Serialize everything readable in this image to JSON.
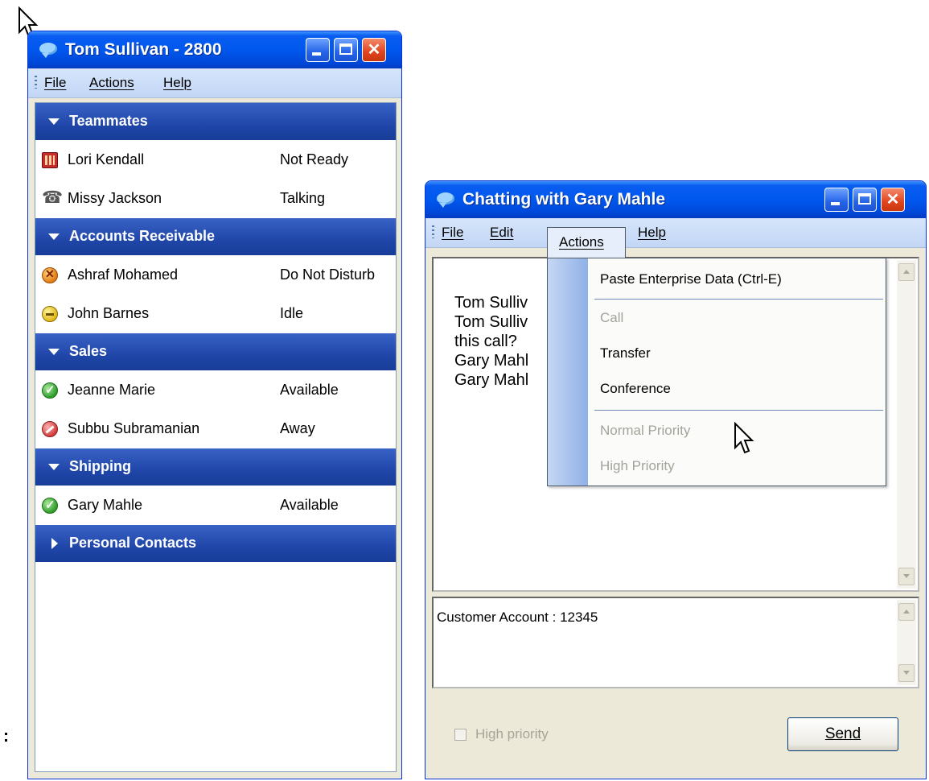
{
  "contacts_window": {
    "title": "Tom Sullivan - 2800",
    "menu": [
      "File",
      "Actions",
      "Help"
    ],
    "groups": [
      {
        "name": "Teammates",
        "expanded": true,
        "contacts": [
          {
            "name": "Lori Kendall",
            "status": "Not Ready",
            "icon": "not-ready-icon"
          },
          {
            "name": "Missy Jackson",
            "status": "Talking",
            "icon": "phone-handset-icon"
          }
        ]
      },
      {
        "name": "Accounts Receivable",
        "expanded": true,
        "contacts": [
          {
            "name": "Ashraf Mohamed",
            "status": "Do Not Disturb",
            "icon": "do-not-disturb-icon"
          },
          {
            "name": "John Barnes",
            "status": "Idle",
            "icon": "idle-icon"
          }
        ]
      },
      {
        "name": "Sales",
        "expanded": true,
        "contacts": [
          {
            "name": "Jeanne Marie",
            "status": "Available",
            "icon": "available-check-icon"
          },
          {
            "name": "Subbu Subramanian",
            "status": "Away",
            "icon": "away-icon"
          }
        ]
      },
      {
        "name": "Shipping",
        "expanded": true,
        "contacts": [
          {
            "name": "Gary Mahle",
            "status": "Available",
            "icon": "available-check-icon"
          }
        ]
      },
      {
        "name": "Personal Contacts",
        "expanded": false,
        "contacts": []
      }
    ]
  },
  "chat_window": {
    "title": "Chatting with Gary Mahle",
    "menu": [
      "File",
      "Edit",
      "Actions",
      "Help"
    ],
    "transcript": [
      "Tom Sulliv",
      "Tom Sulliv",
      "this call?",
      "Gary Mahl",
      "Gary Mahl"
    ],
    "compose_text": "Customer Account : 12345",
    "high_priority_label": "High priority",
    "high_priority_checked": false,
    "send_label": "Send",
    "actions_menu": [
      {
        "label": "Paste Enterprise Data (Ctrl-E)",
        "enabled": true
      },
      {
        "separator": true
      },
      {
        "label": "Call",
        "enabled": false
      },
      {
        "label": "Transfer",
        "enabled": true
      },
      {
        "label": "Conference",
        "enabled": true
      },
      {
        "separator": true
      },
      {
        "label": "Normal Priority",
        "enabled": false
      },
      {
        "label": "High Priority",
        "enabled": false
      }
    ]
  },
  "colors": {
    "titlebar_blue": "#0058ee",
    "group_header_blue": "#1f46a8",
    "menubar": "#c2d6f5",
    "close_red": "#e0441e"
  }
}
